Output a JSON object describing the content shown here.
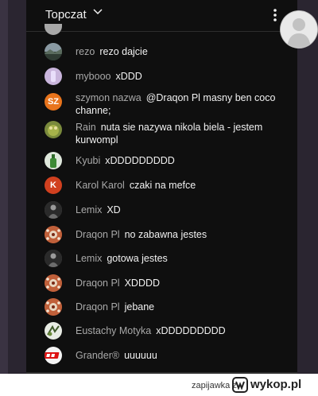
{
  "header": {
    "title": "Topczat"
  },
  "messages": [
    {
      "author": "rezo",
      "text": "rezo dajcie",
      "avatar": "landscape-avatar-icon",
      "color": "#4b5e52"
    },
    {
      "author": "mybooo",
      "text": "xDDD",
      "avatar": "lavender-avatar-icon",
      "color": "#c9b5dc"
    },
    {
      "author": "szymon nazwa",
      "text": "@Draqon Pl masny ben coco channe;",
      "avatar_initials": "SZ",
      "color": "#e8741c"
    },
    {
      "author": "Rain",
      "text": "nuta sie nazywa nikola biela - jestem kurwompl",
      "avatar": "frog-avatar-icon",
      "color": "#7a8a3c"
    },
    {
      "author": "Kyubi",
      "text": "xDDDDDDDDD",
      "avatar": "bottle-avatar-icon",
      "color": "#dfe8dc"
    },
    {
      "author": "Karol Karol",
      "text": "czaki na mefce",
      "avatar_initials": "K",
      "color": "#d1401f"
    },
    {
      "author": "Lemix",
      "text": "XD",
      "avatar": "figure-avatar-icon",
      "color": "#5d5d5d"
    },
    {
      "author": "Draqon Pl",
      "text": "no zabawna jestes",
      "avatar": "pattern-avatar-icon",
      "color": "#b8512d"
    },
    {
      "author": "Lemix",
      "text": "gotowa jestes",
      "avatar": "figure-avatar-icon",
      "color": "#5d5d5d"
    },
    {
      "author": "Draqon Pl",
      "text": "XDDDD",
      "avatar": "pattern-avatar-icon",
      "color": "#b8512d"
    },
    {
      "author": "Draqon Pl",
      "text": "jebane",
      "avatar": "pattern-avatar-icon",
      "color": "#b8512d"
    },
    {
      "author": "Eustachy Motyka",
      "text": "xDDDDDDDDD",
      "avatar": "drawing-avatar-icon",
      "color": "#e8ece4"
    },
    {
      "author": "Grander®",
      "text": "uuuuuu",
      "avatar": "gr-logo-avatar-icon",
      "color": "#f4f4f4"
    }
  ],
  "watermark": {
    "text": "zapijawka z",
    "site": "wykop.pl"
  }
}
